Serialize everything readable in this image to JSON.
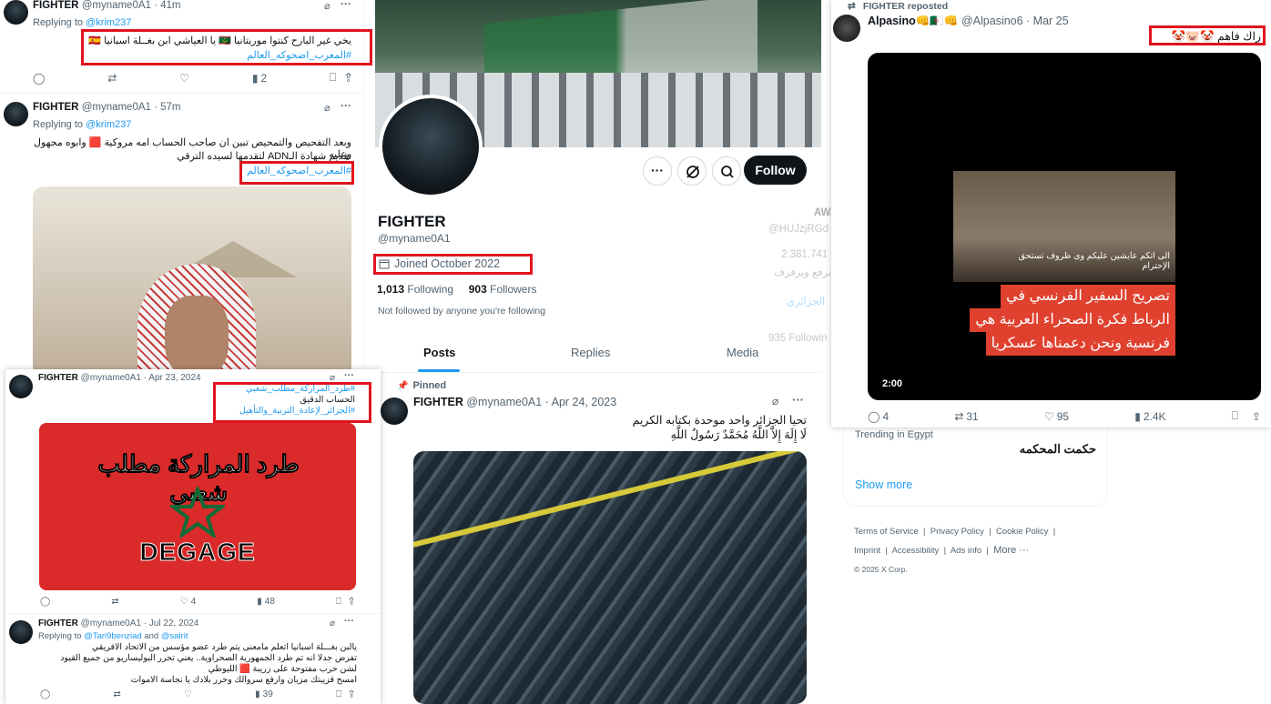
{
  "left_tweet1": {
    "name": "FIGHTER",
    "handle": "@myname0A1 · 41m",
    "replying_prefix": "Replying to",
    "replying_to": "@krim237",
    "text": "يخي غير البارح كنتوا موريتانيا 🇲🇷 يا العياشي ابن بغــلة اسبانيا 🇪🇸",
    "hashtag": "#المعرب_اضحوكه_العالم",
    "views": "2"
  },
  "left_tweet2": {
    "name": "FIGHTER",
    "handle": "@myname0A1 · 57m",
    "replying_prefix": "Replying to",
    "replying_to": "@krim237",
    "text_line1": "وبعد التفحيص والتمحيص تبين ان صاحب الحساب امه مروكية 🟥 وابوه مجهول وعليه",
    "text_line2": "تقديم شهادة الـADN لتقدمها لسيده الترقي",
    "hashtag": "#المعرب_اضحوكه_العالم"
  },
  "left_tweet3": {
    "name": "FIGHTER",
    "handle": "@myname0A1 · Apr 23, 2024",
    "hashtag1": "#طرد_المراركة_مطلب_شعبي",
    "text": "الحساب الدقيق",
    "hashtag2": "#الجزائر_لإعادة_التربية_والتأهيل",
    "image_title": "طرد المراركة مطلب شعبي",
    "image_word": "DEGAGE",
    "likes": "4",
    "views": "48"
  },
  "left_tweet4": {
    "name": "FIGHTER",
    "handle": "@myname0A1 · Jul 22, 2024",
    "replying_prefix": "Replying to",
    "replying_to": "@Tari9benziad",
    "replying_and": "and",
    "replying_to2": "@salrit",
    "line1": "يالبن بغـــلة اسبانيا اتعلم مامعنى يتم طرد عضو مؤسس من الاتحاد الافريقي",
    "line2": "تفرض جدلا انه تم طرد الجمهورية الصحراوية.. يعني تحرر البوليساريو من جميع القيود",
    "line3": "لشن حرب مفتوحة على زريبة 🟥 الليوطي",
    "line4": "امسح قزيبتك مزيان وارفع سروالك وحرر بلادك يا نجاسة الاموات",
    "views": "39"
  },
  "profile": {
    "name": "FIGHTER",
    "handle": "@myname0A1",
    "joined": "Joined October 2022",
    "following_count": "1,013",
    "following_label": "Following",
    "followers_count": "903",
    "followers_label": "Followers",
    "not_followed": "Not followed by anyone you're following",
    "follow_button": "Follow",
    "tabs": [
      "Posts",
      "Replies",
      "Media"
    ],
    "active_tab": "Posts"
  },
  "pinned": {
    "label": "Pinned",
    "name": "FIGHTER",
    "handle": "@myname0A1 · Apr 24, 2023",
    "line1": "تحيا الجزائر واحد موحدة بكتابه الكريم",
    "line2": "لَا إِلَهَ إِلاَّ اللَّهُ مُحَمَّدٌ رَسُولُ اللَّهِ"
  },
  "ghost": {
    "partial_name": "AWA",
    "handle": "@HUJzjRGd",
    "count": "2.381.741",
    "text1": "برفع ويرفرف",
    "text2": "الجزائري",
    "following": "935 Followin"
  },
  "right_tweet": {
    "repost_label": "FIGHTER reposted",
    "name": "Alpasino",
    "name_emojis": "👊🇩🇿👊",
    "handle": "@Alpasino6 · Mar 25",
    "text": "راك فاهم 🤡🐷🤡",
    "video_caption_line1": "تصريح السفير الفرنسي في",
    "video_caption_line2": "الرباط فكرة الصحراء العربية هي",
    "video_caption_line3": "فرنسية ونحن دعمناها عسكريا",
    "video_subtitle": "الى اتكم عايشين عليكم وى ظروف تستحق الإحترام",
    "video_duration": "2:00",
    "replies": "4",
    "reposts": "31",
    "likes": "95",
    "views": "2.4K"
  },
  "trending": {
    "label": "Trending in Egypt",
    "topic": "حكمت المحكمه",
    "show_more": "Show more"
  },
  "footer": {
    "links": [
      "Terms of Service",
      "Privacy Policy",
      "Cookie Policy",
      "Imprint",
      "Accessibility",
      "Ads info",
      "More ···"
    ],
    "copyright": "© 2025 X Corp."
  },
  "colors": {
    "accent": "#1d9bf0",
    "highlight": "#e0141e",
    "text": "#0f1419",
    "muted": "#536471"
  }
}
